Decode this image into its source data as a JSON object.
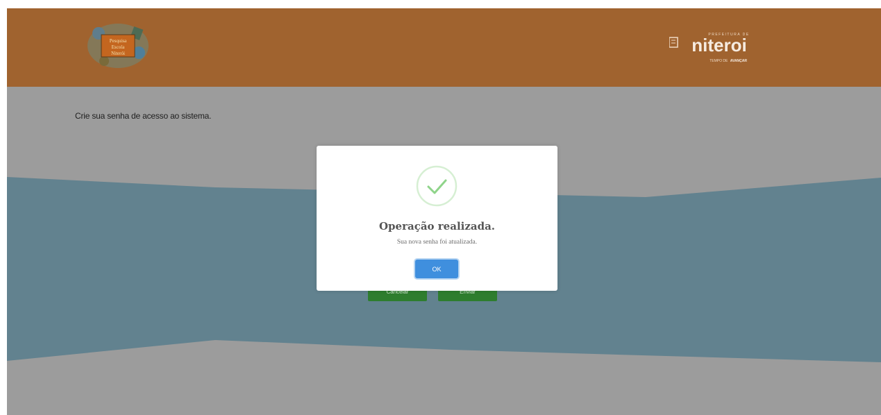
{
  "header": {
    "left_logo": {
      "icon": "pesquisa-escola-logo",
      "lines": [
        "Pesquisa",
        "Escola",
        "Niterói"
      ]
    },
    "right_logo": {
      "icon": "prefeitura-niteroi-logo",
      "prefix": "PREFEITURA DE",
      "name": "niteroi",
      "tagline_a": "TEMPO DE",
      "tagline_b": "AVANÇAR"
    }
  },
  "page": {
    "instruction": "Crie sua senha de acesso ao sistema."
  },
  "behind_buttons": {
    "cancel_label": "Cancelar",
    "submit_label": "Enviar"
  },
  "dialog": {
    "icon": "success-check-icon",
    "title": "Operação realizada.",
    "message": "Sua nova senha foi atualizada.",
    "ok_label": "OK"
  },
  "colors": {
    "header_bg": "#a0632f",
    "page_bg": "#9c9c9c",
    "band": "#62828f",
    "green_button": "#2e7d2e",
    "ok_button": "#3f8fde",
    "success": "#8fd48a"
  }
}
